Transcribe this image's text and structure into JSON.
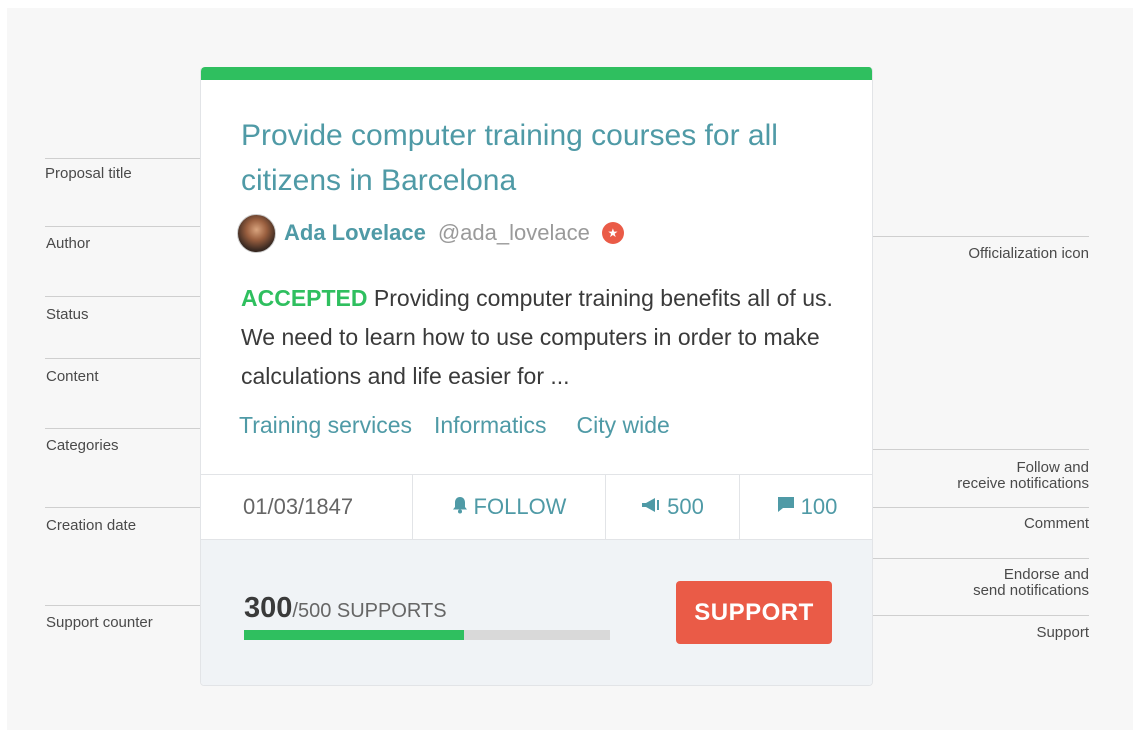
{
  "annotations": {
    "left": {
      "proposal_title": "Proposal title",
      "author": "Author",
      "status": "Status",
      "content": "Content",
      "categories": "Categories",
      "creation_date": "Creation date",
      "support_counter": "Support counter"
    },
    "right": {
      "officialization_icon": "Officialization icon",
      "follow_line1": "Follow and",
      "follow_line2": "receive notifications",
      "comment": "Comment",
      "endorse_line1": "Endorse and",
      "endorse_line2": "send notifications",
      "support": "Support"
    }
  },
  "card": {
    "title": "Provide computer training courses for all citizens in Barcelona",
    "author": {
      "name": "Ada Lovelace",
      "handle": "@ada_lovelace",
      "officialization_icon": "star-badge-icon"
    },
    "status": "ACCEPTED",
    "content": "Providing computer training benefits all of us. We need to learn how to use computers in order to make calculations and life easier for ...",
    "categories": [
      "Training services",
      "Informatics",
      "City wide"
    ],
    "creation_date": "01/03/1847",
    "follow_label": "FOLLOW",
    "endorsements_count": "500",
    "comments_count": "100",
    "supports": {
      "count": "300",
      "total_label": "/500 SUPPORTS",
      "progress_fraction": 0.6
    },
    "support_button": "SUPPORT"
  },
  "colors": {
    "accent_green": "#2fbf5f",
    "teal_text": "#4f9aa6",
    "support_red": "#ea5b47"
  }
}
